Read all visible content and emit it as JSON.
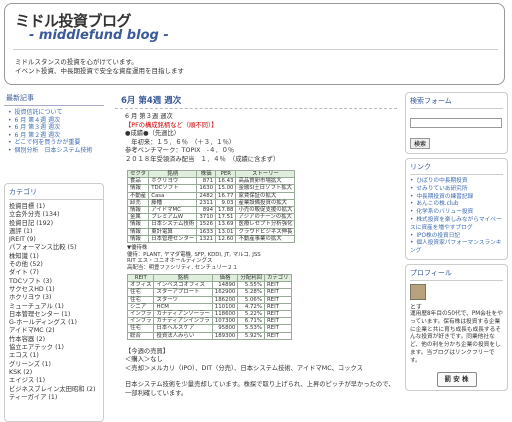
{
  "header": {
    "title": "ミドル投資ブログ",
    "subtitle": "- middlefund blog -",
    "desc_line1": "ミドルスタンスの投資を心がけています。",
    "desc_line2": "イベント投資、中長期投資で安全な資産運用を目指します"
  },
  "recent": {
    "title": "最新記事",
    "items": [
      "投資信託について",
      "6 月 第４週 週次",
      "6 月 第３週 週次",
      "6 月 第２週 週次",
      "どこで何を買うかが重要",
      "個別分析　日本システム技術"
    ]
  },
  "category": {
    "title": "カテゴリ",
    "items": [
      "投資目標 (1)",
      "立会外分売 (134)",
      "投資日記 (192)",
      "週評 (1)",
      "JREIT (9)",
      "パフォーマンス比較 (5)",
      "株知識 (1)",
      "その他 (52)",
      "ダイト (7)",
      "TDCソフト (3)",
      "サクセスHD (1)",
      "ホクリヨウ (3)",
      "ミューチュアル (1)",
      "日本管理センター (1)",
      "G-ホールディングス (1)",
      "アイドマMC (2)",
      "竹本容器 (2)",
      "協立エアテック (1)",
      "エコス (1)",
      "グリーンズ (1)",
      "KSK (2)",
      "エイジス (1)",
      "ビジネスブレイン太田昭和 (2)",
      "ティーガイア (1)"
    ]
  },
  "post": {
    "title": "6月 第4週 週次",
    "lines": [
      "6 月 第３週 週次",
      "【PFの構成銘柄など（順不同）】",
      "●成績●（先週比）",
      "　年初来：１５．６％　（＋３．１％）",
      "参考ベンチマーク：TOPIX　-４．０％",
      "２０１８年受領済み配当　１．４％　（成績に含まず）"
    ],
    "t1_headers": [
      "セクタ",
      "銘柄",
      "株価",
      "PER",
      "ストーリー"
    ],
    "t1_rows": [
      [
        "食品",
        "ホクリヨウ",
        "871",
        "16.43",
        "高品質卵市場拡大"
      ],
      [
        "情報",
        "TDCソフト",
        "1630",
        "15.00",
        "金融SI土日ソフト拡大"
      ],
      [
        "不動産",
        "Casa",
        "2482",
        "16.77",
        "家賃保証の拡大"
      ],
      [
        "卸売",
        "藤幡",
        "2311",
        "9.03",
        "産業設備投資の拡大"
      ],
      [
        "情報",
        "アイドマMC",
        "894",
        "17.88",
        "小売の販促支援の拡大"
      ],
      [
        "金属",
        "プレミアムW",
        "3710",
        "17.51",
        "アジアのチーンの拡大"
      ],
      [
        "情報",
        "日本システム技術",
        "1526",
        "13.69",
        "医療レセプト分析強化"
      ],
      [
        "情報",
        "東計電算",
        "1633",
        "13.01",
        "クラウドビジネス伸長"
      ],
      [
        "情報",
        "日本管理センター",
        "1321",
        "12.60",
        "不動産事業の拡大"
      ]
    ],
    "watch_title": "▼優待株",
    "watch_line1": "優待：PLANT, ヤマダ電機, SFP, KDDI, JT, マルコ, JSS",
    "watch_line2": "RIT エス・ユニオホールディングス",
    "watch_line3": "高配当：明豊ファシリティ, センチュリー２１",
    "t2_headers": [
      "REIT",
      "銘柄",
      "価格",
      "分配利回",
      "カテゴリ"
    ],
    "t2_rows": [
      [
        "オフィス",
        "インベスコオフィス",
        "14890",
        "5.55%",
        "REIT"
      ],
      [
        "住宅",
        "スターアプロート",
        "162900",
        "5.28%",
        "REIT"
      ],
      [
        "住宅",
        "スターツ",
        "186200",
        "5.06%",
        "REIT"
      ],
      [
        "シニア",
        "HCM",
        "110100",
        "4.72%",
        "REIT"
      ],
      [
        "インフラ",
        "カナディアンソーラー",
        "118600",
        "5.22%",
        "REIT"
      ],
      [
        "インフラ",
        "カナディアンインフラ",
        "107300",
        "6.71%",
        "REIT"
      ],
      [
        "住宅",
        "日本ヘルスケア",
        "95800",
        "5.53%",
        "REIT"
      ],
      [
        "総合",
        "投資法人みらい",
        "189300",
        "5.92%",
        "REIT"
      ]
    ],
    "changes_title": "【今週の売買】",
    "changes_sub": "＜購入＞なし",
    "changes_line": "＜売却＞メルカリ（IPO）、DIT（分売）、日本システム技術、アイドマMC、コックス",
    "closing_line": "日本システム技術を少量売却しています。株探で取り上げられ、上昇のピッチが早かったので、一部利確しています。"
  },
  "search": {
    "title": "検索フォーム",
    "button": "検索"
  },
  "links": {
    "title": "リンク",
    "items": [
      "ひばりの中長期投資",
      "せみりていあ研究所",
      "中長期投資の練習記録",
      "あんこの株.club",
      "化学系のバリュー投資",
      "株式投資を楽しみながらマイペースに資産を増やすブログ",
      "IPO株の投資日記",
      "個人投資家パフォーマンスランキング"
    ]
  },
  "profile": {
    "title": "プロフィール",
    "name": "とす",
    "text": "運用歴8年目の50代で、PM会社をやっています。保有株は投資する企業に企業と共に育ち成長も成長するそんな投資が好きです。同業他社など、他の利を分かち企業の投資をします。当ブログはリンクフリーです。",
    "stamp": "罰 安 株"
  }
}
